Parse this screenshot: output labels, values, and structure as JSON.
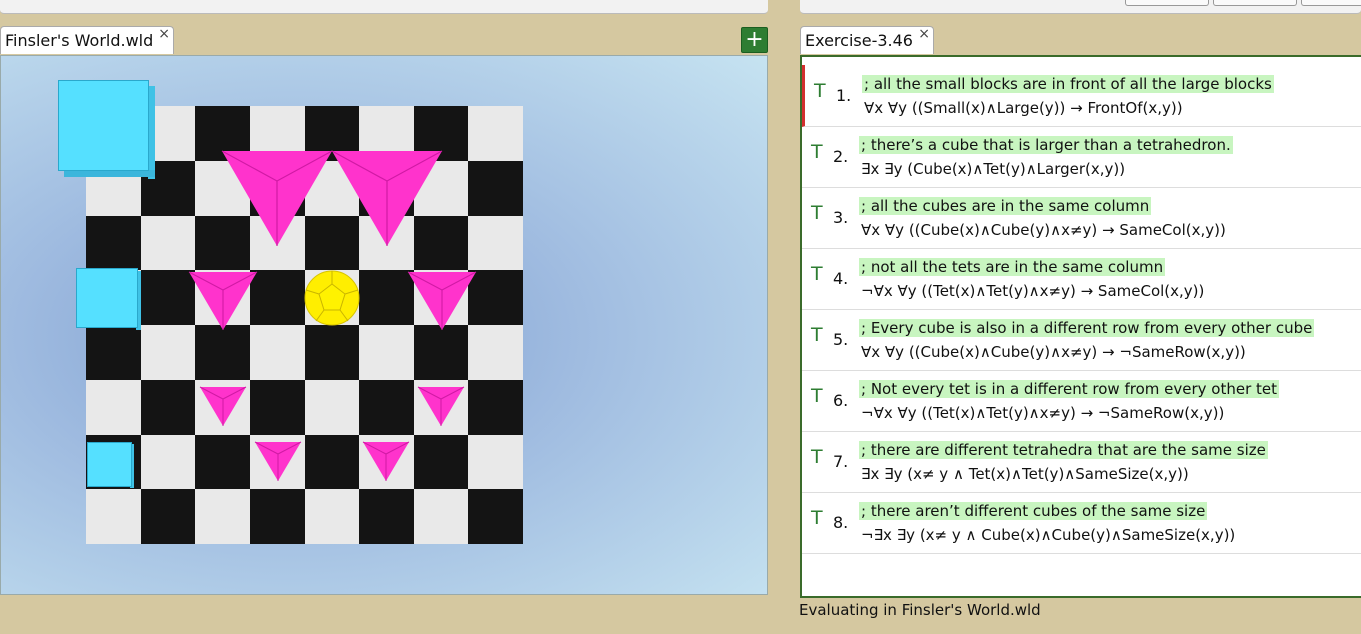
{
  "left_panel": {
    "tab_label": "Finsler's World.wld",
    "tab_close": "×",
    "add_label": "+"
  },
  "right_panel": {
    "tab_label": "Exercise-3.46",
    "tab_close": "×"
  },
  "sentences": [
    {
      "truth": "T",
      "num": "1.",
      "comment": "; all the small blocks are in front of all the large blocks",
      "formula": "∀x ∀y ((Small(x)∧Large(y)) → FrontOf(x,y))",
      "active": true
    },
    {
      "truth": "T",
      "num": "2.",
      "comment": "; there’s a cube that is larger than a tetrahedron.",
      "formula": "∃x ∃y (Cube(x)∧Tet(y)∧Larger(x,y))"
    },
    {
      "truth": "T",
      "num": "3.",
      "comment": "; all the cubes are in the same column",
      "formula": "∀x ∀y ((Cube(x)∧Cube(y)∧x≠y) → SameCol(x,y))"
    },
    {
      "truth": "T",
      "num": "4.",
      "comment": "; not all the tets are in the same column",
      "formula": "¬∀x ∀y ((Tet(x)∧Tet(y)∧x≠y) → SameCol(x,y))"
    },
    {
      "truth": "T",
      "num": "5.",
      "comment": "; Every cube is also in a different row from every other cube",
      "formula": "∀x ∀y ((Cube(x)∧Cube(y)∧x≠y) → ¬SameRow(x,y))"
    },
    {
      "truth": "T",
      "num": "6.",
      "comment": "; Not every tet is in a different row from every other tet",
      "formula": "¬∀x ∀y ((Tet(x)∧Tet(y)∧x≠y) → ¬SameRow(x,y))"
    },
    {
      "truth": "T",
      "num": "7.",
      "comment": "; there are different tetrahedra that are the same size",
      "formula": "∃x ∃y (x≠ y ∧ Tet(x)∧Tet(y)∧SameSize(x,y))"
    },
    {
      "truth": "T",
      "num": "8.",
      "comment": "; there aren’t different cubes of the same size",
      "formula": "¬∃x ∃y (x≠ y ∧ Cube(x)∧Cube(y)∧SameSize(x,y))"
    }
  ],
  "status": "Evaluating in Finsler's World.wld",
  "colors": {
    "cube": "#55e0ff",
    "tet": "#ff33cc",
    "dodec": "#ffee00",
    "truth_true": "#2e7d32",
    "comment_bg": "#c8f5c0"
  }
}
